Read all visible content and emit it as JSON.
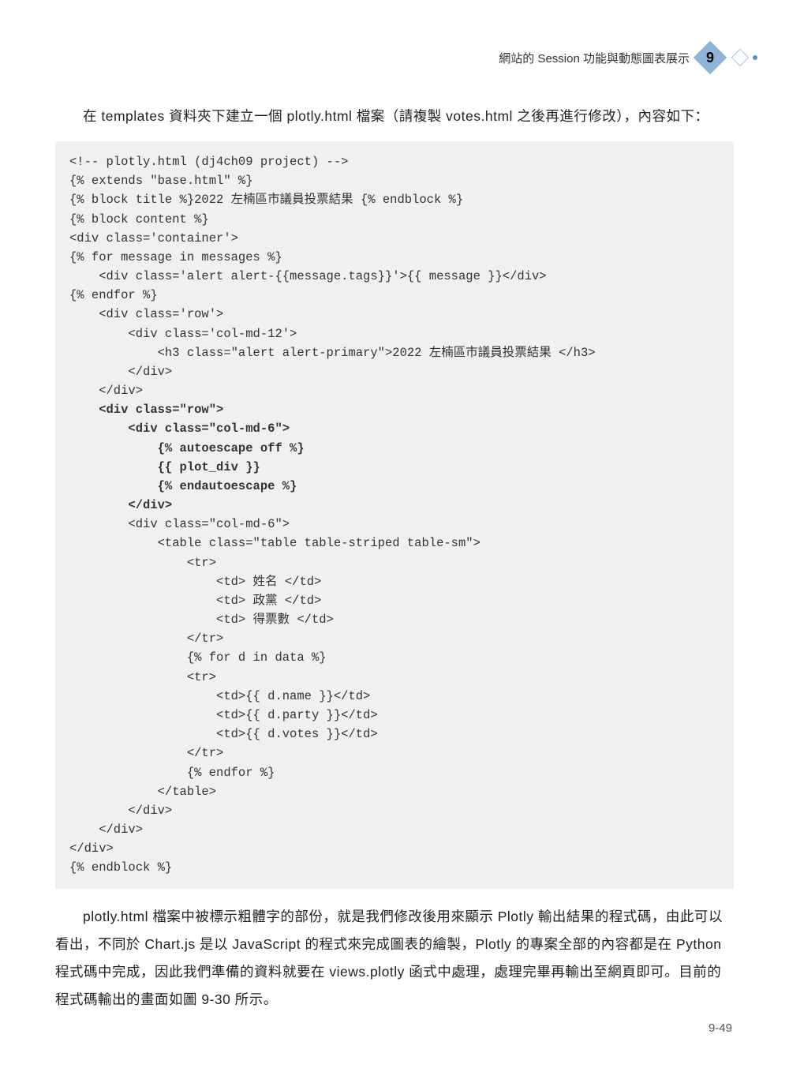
{
  "header": {
    "title": "網站的 Session 功能與動態圖表展示",
    "chapter": "9"
  },
  "para1": "在 templates 資料夾下建立一個 plotly.html 檔案（請複製 votes.html 之後再進行修改），內容如下：",
  "code": {
    "l01": "<!-- plotly.html (dj4ch09 project) -->",
    "l02": "{% extends \"base.html\" %}",
    "l03": "{% block title %}2022 左楠區市議員投票結果 {% endblock %}",
    "l04": "{% block content %}",
    "l05": "<div class='container'>",
    "l06": "{% for message in messages %}",
    "l07": "    <div class='alert alert-{{message.tags}}'>{{ message }}</div>",
    "l08": "{% endfor %}",
    "l09": "    <div class='row'>",
    "l10": "        <div class='col-md-12'>",
    "l11": "            <h3 class=\"alert alert-primary\">2022 左楠區市議員投票結果 </h3>",
    "l12": "        </div>",
    "l13": "    </div>",
    "l14": "    <div class=\"row\">",
    "l15": "        <div class=\"col-md-6\">",
    "l16": "            {% autoescape off %}",
    "l17": "            {{ plot_div }}",
    "l18": "            {% endautoescape %}",
    "l19": "        </div>",
    "l20": "        <div class=\"col-md-6\">",
    "l21": "            <table class=\"table table-striped table-sm\">",
    "l22": "                <tr>",
    "l23": "                    <td> 姓名 </td>",
    "l24": "                    <td> 政黨 </td>",
    "l25": "                    <td> 得票數 </td>",
    "l26": "                </tr>",
    "l27": "                {% for d in data %}",
    "l28": "                <tr>",
    "l29": "                    <td>{{ d.name }}</td>",
    "l30": "                    <td>{{ d.party }}</td>",
    "l31": "                    <td>{{ d.votes }}</td>",
    "l32": "                </tr>",
    "l33": "                {% endfor %}",
    "l34": "            </table>",
    "l35": "        </div>",
    "l36": "    </div>",
    "l37": "</div>",
    "l38": "{% endblock %}"
  },
  "para2": "plotly.html 檔案中被標示粗體字的部份，就是我們修改後用來顯示 Plotly 輸出結果的程式碼，由此可以看出，不同於 Chart.js 是以 JavaScript 的程式來完成圖表的繪製，Plotly 的專案全部的內容都是在 Python 程式碼中完成，因此我們準備的資料就要在 views.plotly 函式中處理，處理完畢再輸出至網頁即可。目前的程式碼輸出的畫面如圖 9-30 所示。",
  "pageNum": "9-49"
}
